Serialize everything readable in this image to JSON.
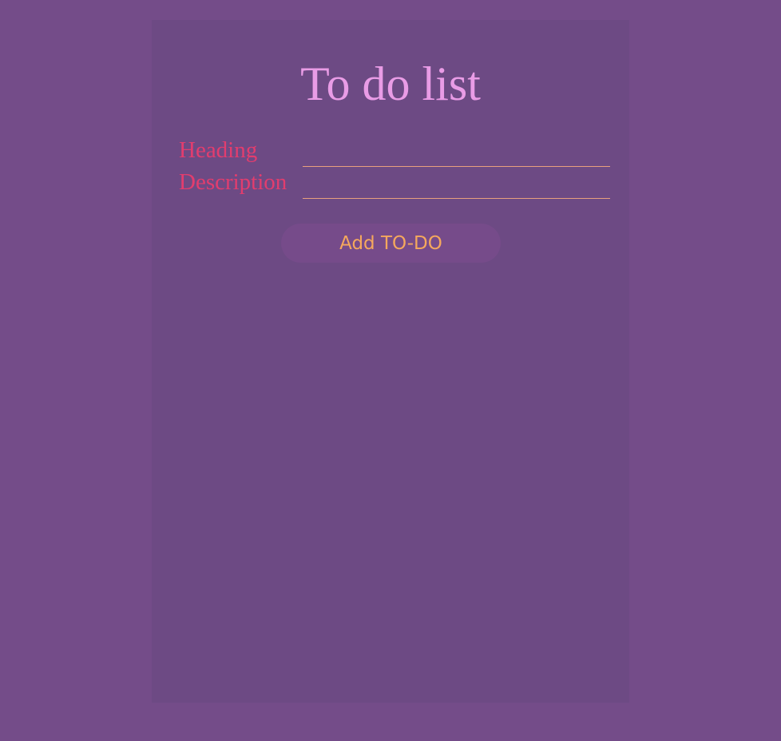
{
  "title": "To do list",
  "form": {
    "heading_label": "Heading",
    "heading_value": "",
    "description_label": "Description",
    "description_value": "",
    "add_button": "Add TO-DO"
  },
  "colors": {
    "background": "#744c89",
    "panel": "#6d4a84",
    "title": "#e99ce6",
    "label": "#e23d6e",
    "button_text": "#f5a85d"
  }
}
